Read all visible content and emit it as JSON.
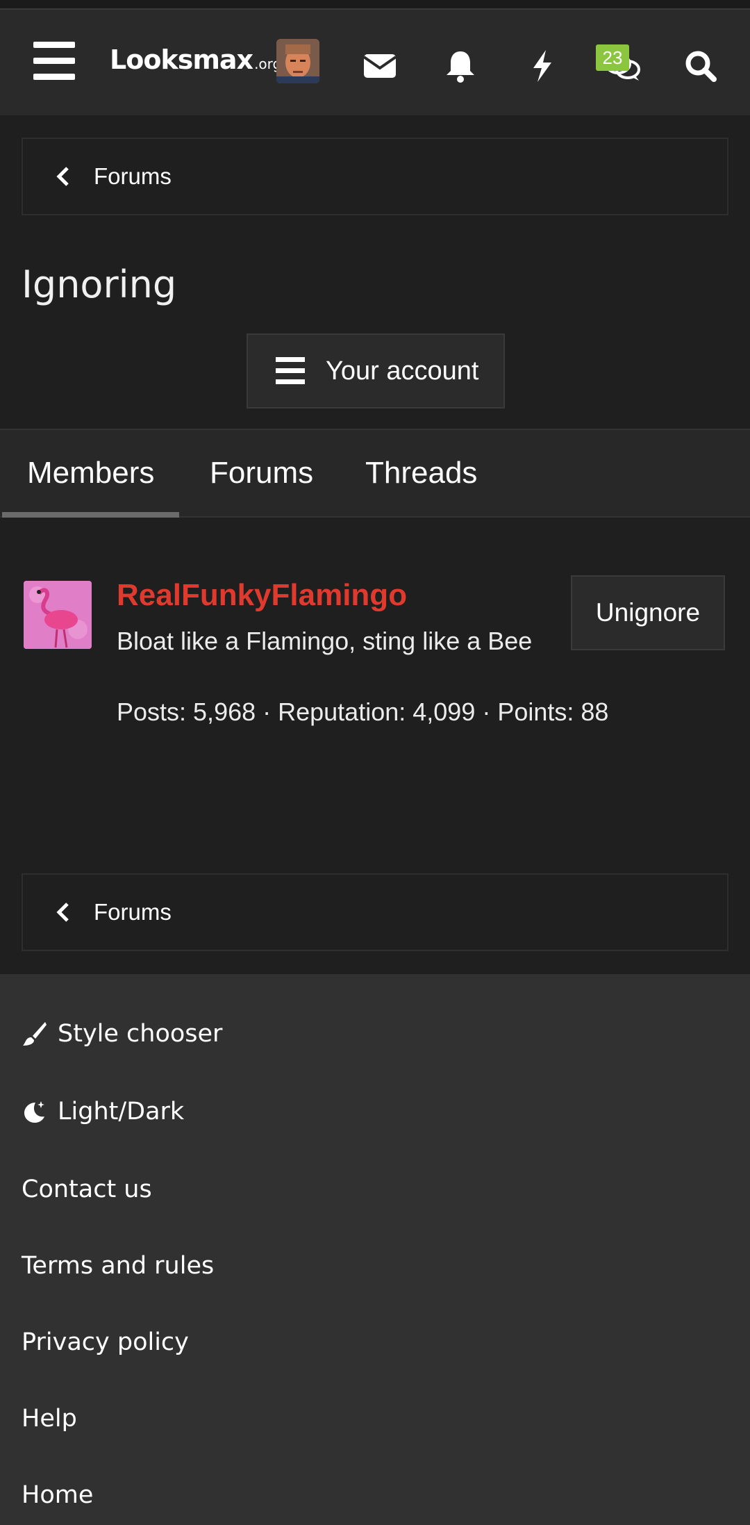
{
  "header": {
    "logo_main": "Looksmax",
    "logo_tld": ".org",
    "chat_badge": "23",
    "icons": [
      "menu-icon",
      "user-avatar",
      "envelope-icon",
      "bell-icon",
      "bolt-icon",
      "chat-bubbles-icon",
      "search-icon"
    ]
  },
  "breadcrumb_top": {
    "label": "Forums"
  },
  "page": {
    "title": "Ignoring"
  },
  "account_button": {
    "label": "Your account"
  },
  "tabs": [
    {
      "label": "Members",
      "active": true
    },
    {
      "label": "Forums",
      "active": false
    },
    {
      "label": "Threads",
      "active": false
    }
  ],
  "member": {
    "name": "RealFunkyFlamingo",
    "bio": "Bloat like a Flamingo, sting like a Bee",
    "stats": "Posts: 5,968 · Reputation: 4,099 · Points: 88",
    "action_label": "Unignore"
  },
  "breadcrumb_bottom": {
    "label": "Forums"
  },
  "footer": {
    "style_chooser": "Style chooser",
    "light_dark": "Light/Dark",
    "links": [
      "Contact us",
      "Terms and rules",
      "Privacy policy",
      "Help",
      "Home"
    ]
  },
  "colors": {
    "background": "#1f1f1f",
    "header": "#2a2a2a",
    "footer": "#313131",
    "username": "#e03a2e",
    "badge": "#8cc63f"
  }
}
